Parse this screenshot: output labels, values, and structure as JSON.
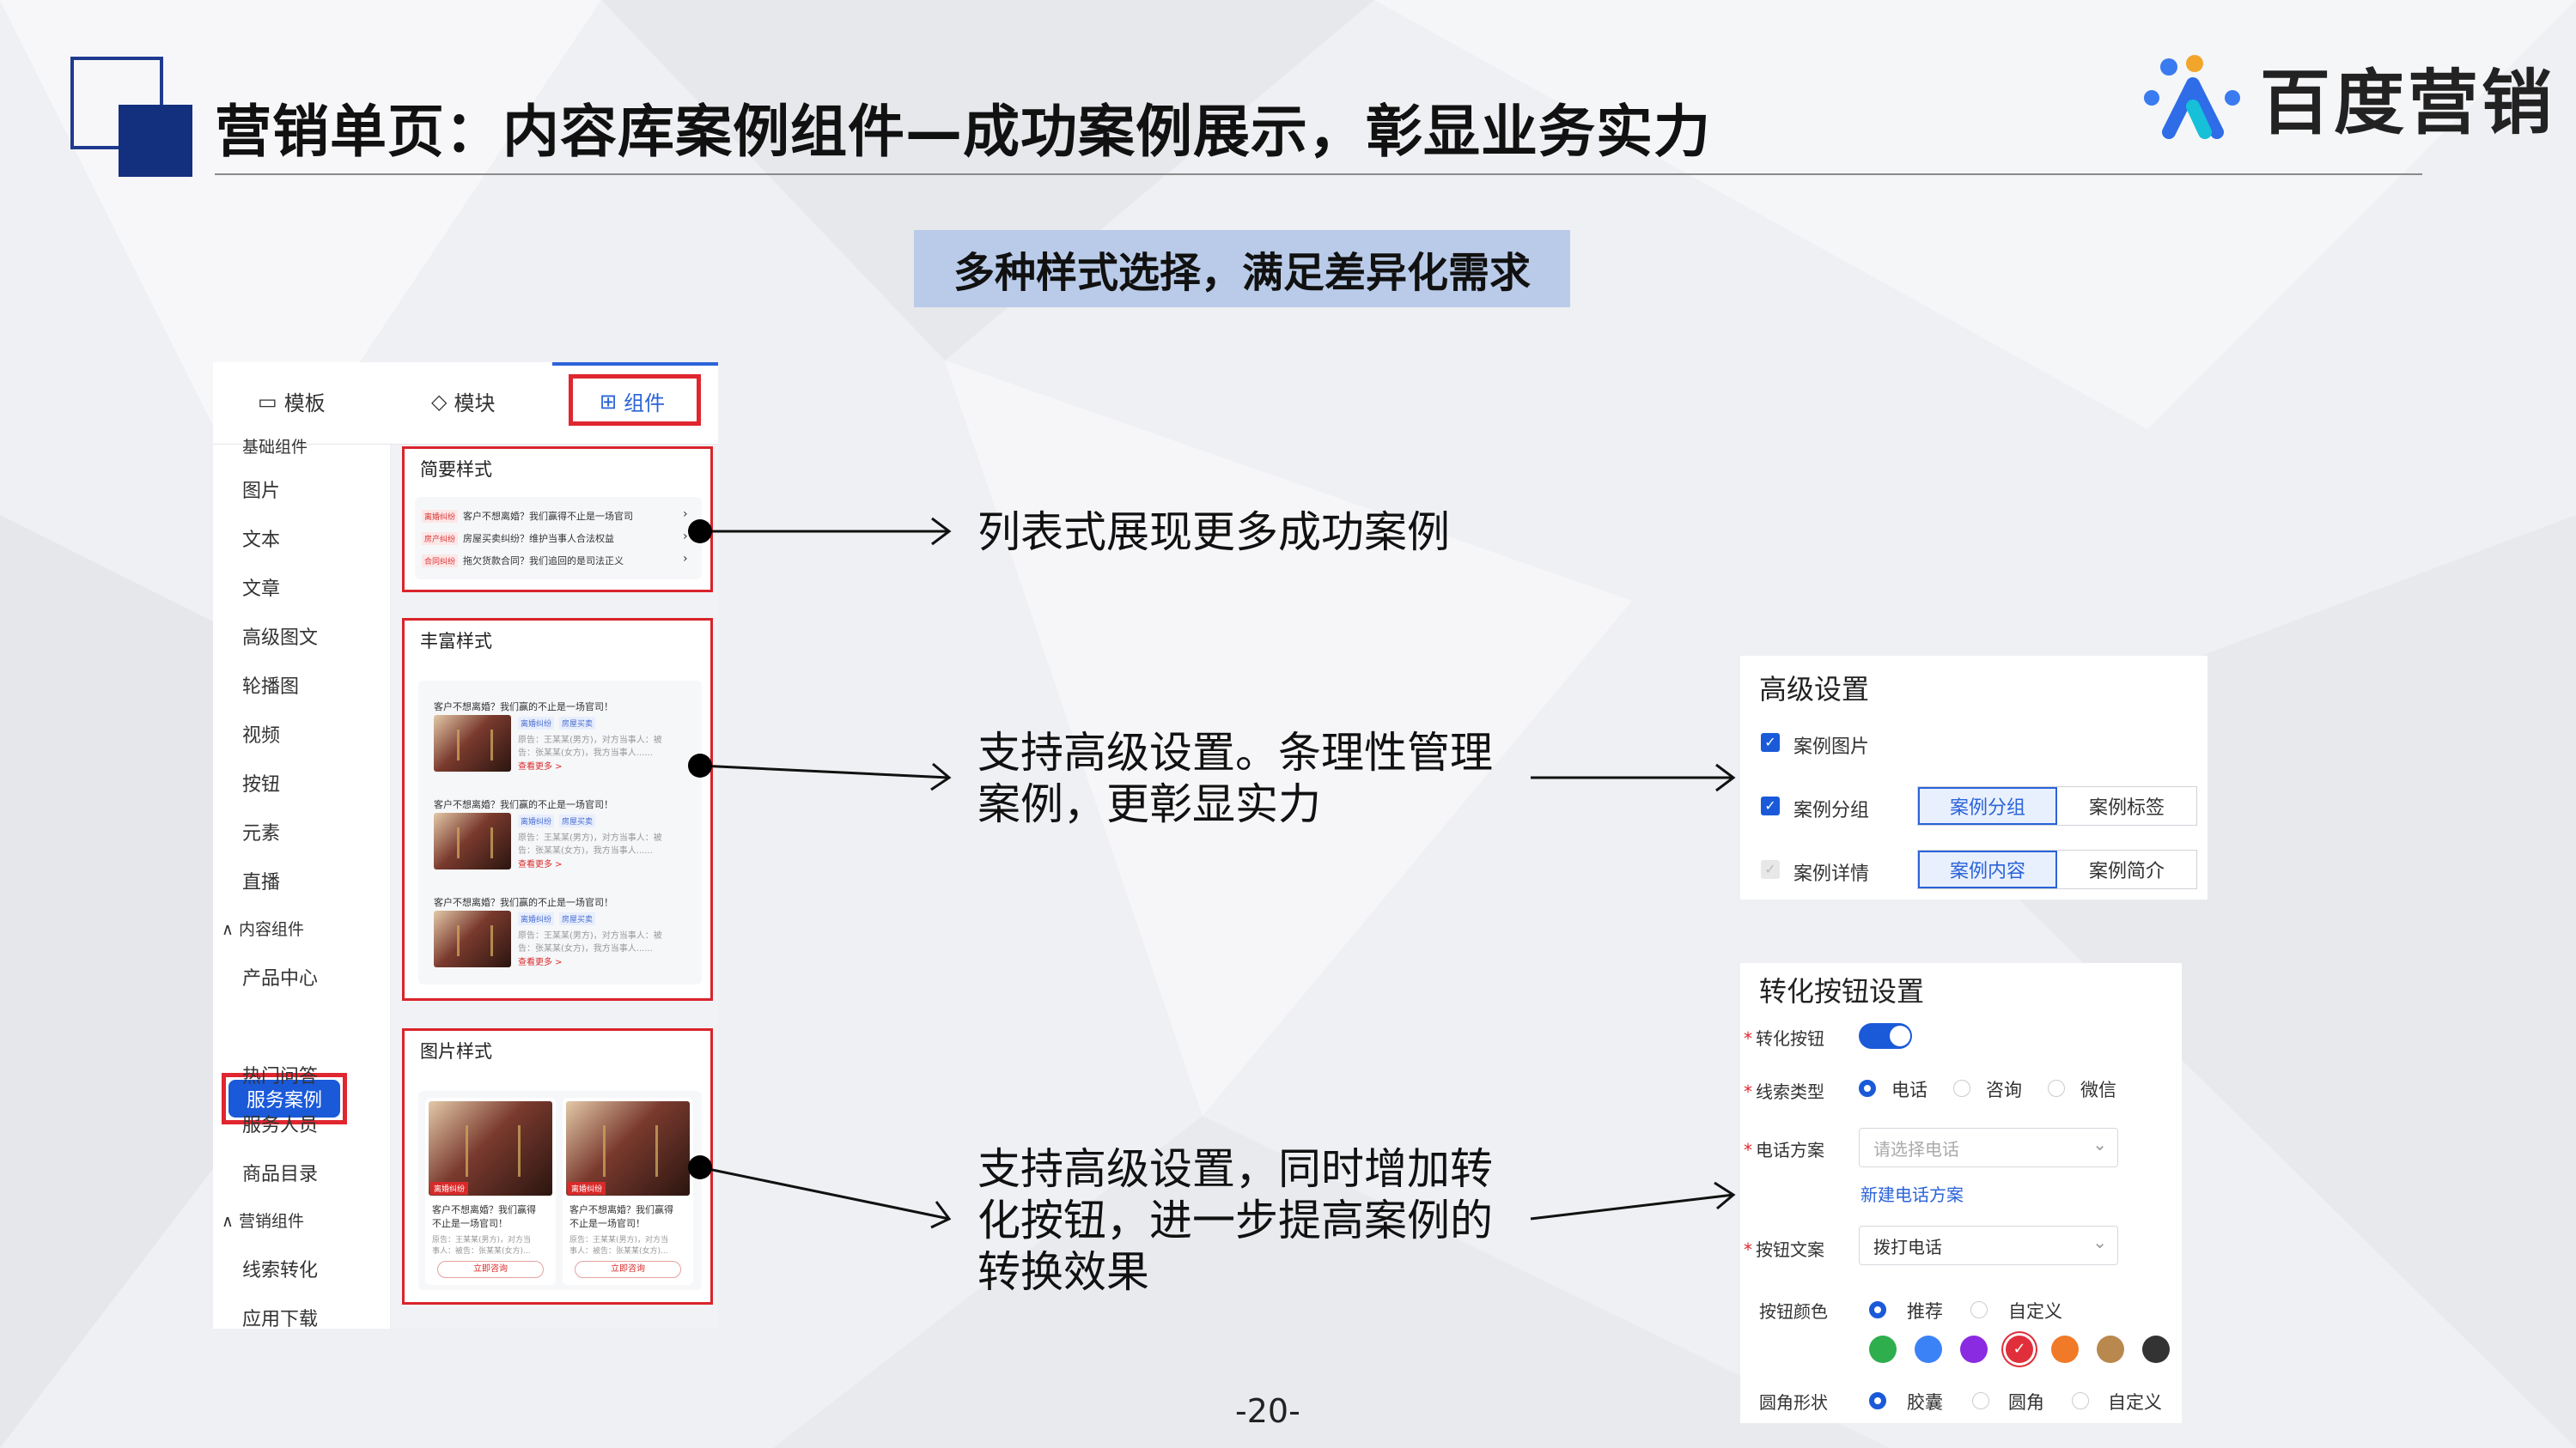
{
  "header": {
    "title": "营销单页：内容库案例组件—成功案例展示，彰显业务实力",
    "brand": "百度营销",
    "subtitle": "多种样式选择，满足差异化需求"
  },
  "panel": {
    "tabs": [
      {
        "label": "模板",
        "icon": "template-icon"
      },
      {
        "label": "模块",
        "icon": "module-icon"
      },
      {
        "label": "组件",
        "icon": "component-icon"
      }
    ],
    "sidebar": {
      "cut_top": "基础组件",
      "items_a": [
        "图片",
        "文本",
        "文章",
        "高级图文",
        "轮播图",
        "视频",
        "按钮",
        "元素",
        "直播"
      ],
      "group_content": "内容组件",
      "items_b": [
        "产品中心",
        "服务案例",
        "热门问答",
        "服务人员",
        "商品目录"
      ],
      "active": "服务案例",
      "group_marketing": "营销组件",
      "items_c": [
        "线索转化",
        "应用下载"
      ]
    },
    "cards": {
      "simple": {
        "title": "简要样式",
        "rows": [
          {
            "tag": "离婚纠纷",
            "text": "客户不想离婚？我们赢得不止是一场官司"
          },
          {
            "tag": "房产纠纷",
            "text": "房屋买卖纠纷？维护当事人合法权益"
          },
          {
            "tag": "合同纠纷",
            "text": "拖欠货款合同？我们追回的是司法正义"
          }
        ]
      },
      "rich": {
        "title": "丰富样式",
        "item_title": "客户不想离婚？我们赢的不止是一场官司！",
        "item_tags": [
          "离婚纠纷",
          "房屋买卖"
        ],
        "item_desc1": "原告：王某某(男方)，对方当事人：被",
        "item_desc2": "告：张某某(女方)，我方当事人......",
        "item_more": "查看更多 >"
      },
      "image": {
        "title": "图片样式",
        "badge": "离婚纠纷",
        "item_title1": "客户不想离婚？我们赢得",
        "item_title2": "不止是一场官司！",
        "item_desc1": "原告：王某某(男方)，对方当",
        "item_desc2": "事人：被告：张某某(女方)...",
        "button": "立即咨询"
      }
    }
  },
  "callouts": {
    "c1": "列表式展现更多成功案例",
    "c2_line1": "支持高级设置。条理性管理",
    "c2_line2": "案例，更彰显实力",
    "c3_line1": "支持高级设置，同时增加转",
    "c3_line2": "化按钮，进一步提高案例的",
    "c3_line3": "转换效果"
  },
  "advanced": {
    "title": "高级设置",
    "case_image": "案例图片",
    "case_group": "案例分组",
    "case_detail": "案例详情",
    "group_opts": [
      "案例分组",
      "案例标签"
    ],
    "detail_opts": [
      "案例内容",
      "案例简介"
    ]
  },
  "convert": {
    "title": "转化按钮设置",
    "toggle_label": "转化按钮",
    "toggle_on": true,
    "lead_label": "线索类型",
    "lead_opts": [
      "电话",
      "咨询",
      "微信"
    ],
    "phone_label": "电话方案",
    "phone_placeholder": "请选择电话",
    "phone_new": "新建电话方案",
    "btntext_label": "按钮文案",
    "btntext_value": "拨打电话",
    "color_label": "按钮颜色",
    "color_opts": [
      "推荐",
      "自定义"
    ],
    "colors": [
      "#2fae4e",
      "#3b82f6",
      "#8a2be2",
      "#e02f3b",
      "#f07a28",
      "#b9884f",
      "#333333"
    ],
    "shape_label": "圆角形状",
    "shape_opts": [
      "胶囊",
      "圆角",
      "自定义"
    ]
  },
  "page_number": "-20-"
}
